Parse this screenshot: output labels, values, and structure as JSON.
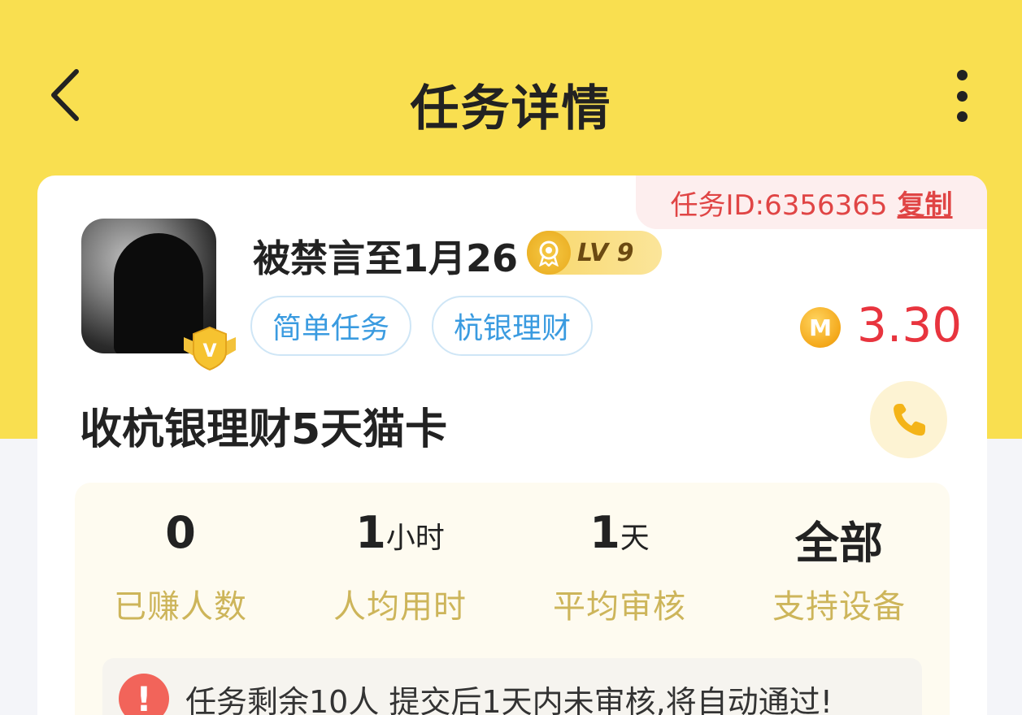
{
  "header": {
    "title": "任务详情",
    "back_icon": "chevron-left-icon",
    "more_icon": "more-vertical-icon"
  },
  "task_id": {
    "label": "任务ID:6356365",
    "copy_label": "复制"
  },
  "publisher": {
    "name": "被禁言至1月26",
    "level": "LV 9",
    "vip_badge": "V"
  },
  "tags": [
    "简单任务",
    "杭银理财"
  ],
  "reward": {
    "coin_symbol": "M",
    "amount": "3.30"
  },
  "task": {
    "title": "收杭银理财5天猫卡"
  },
  "stats": [
    {
      "value": "0",
      "unit": "",
      "label": "已赚人数"
    },
    {
      "value": "1",
      "unit": "小时",
      "label": "人均用时"
    },
    {
      "value": "1",
      "unit": "天",
      "label": "平均审核"
    },
    {
      "value": "全部",
      "unit": "",
      "label": "支持设备"
    }
  ],
  "notice": {
    "icon": "!",
    "text": "任务剩余10人  提交后1天内未审核,将自动通过!"
  },
  "colors": {
    "brand_yellow": "#f9df50",
    "price_red": "#e8343e",
    "tag_blue": "#3a9be0",
    "stat_label_gold": "#cdb55a",
    "warning_red": "#f2645a"
  }
}
